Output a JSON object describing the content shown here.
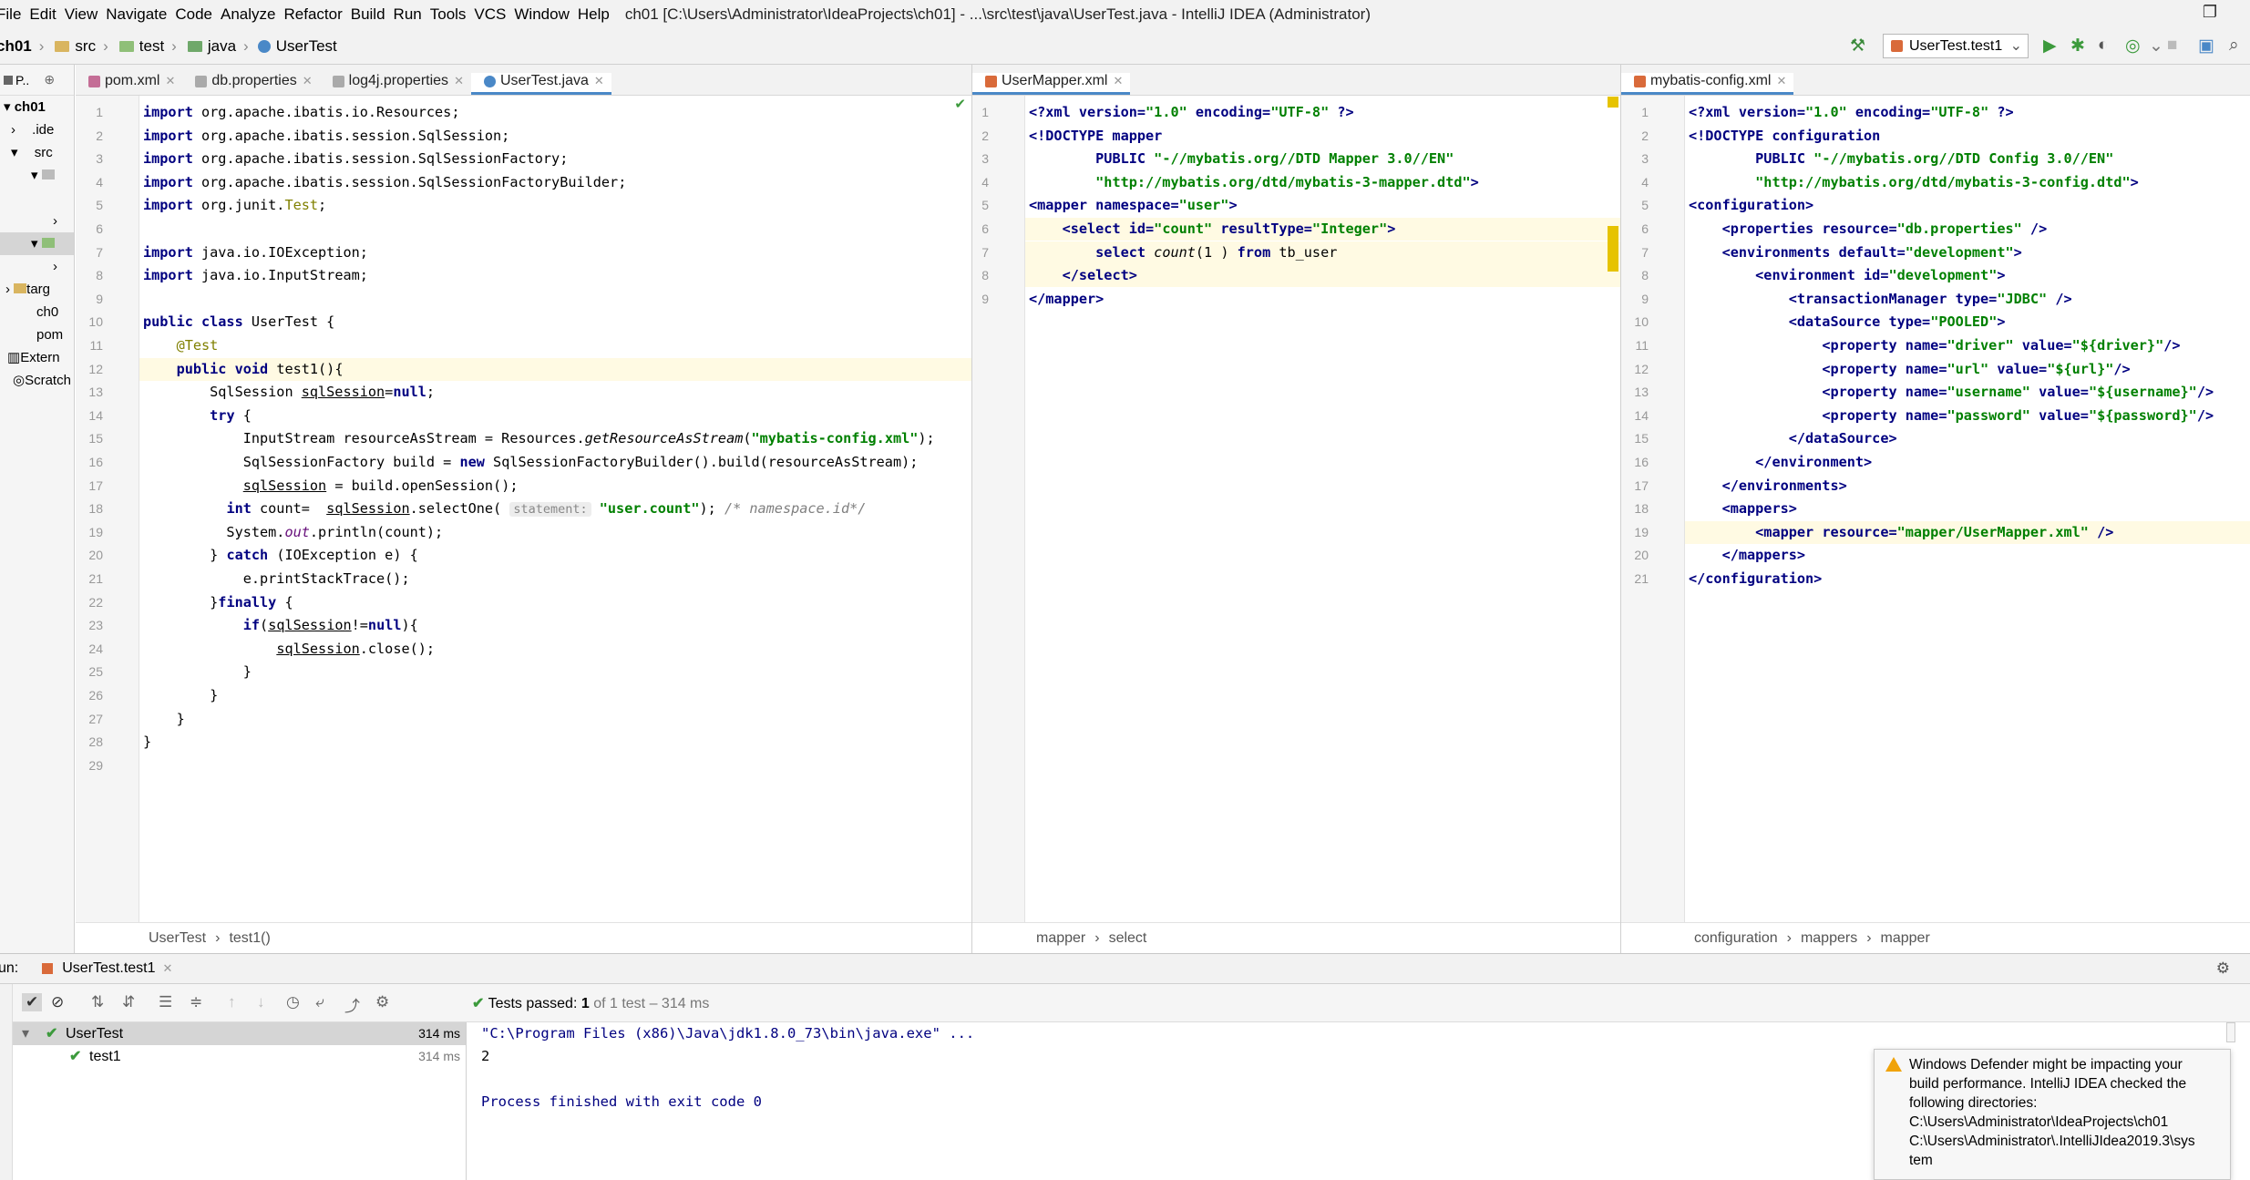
{
  "menubar": {
    "items": [
      "File",
      "Edit",
      "View",
      "Navigate",
      "Code",
      "Analyze",
      "Refactor",
      "Build",
      "Run",
      "Tools",
      "VCS",
      "Window",
      "Help"
    ],
    "title": "ch01 [C:\\Users\\Administrator\\IdeaProjects\\ch01] - ...\\src\\test\\java\\UserTest.java - IntelliJ IDEA (Administrator)"
  },
  "navbar": {
    "crumbs": [
      "ch01",
      "src",
      "test",
      "java",
      "UserTest"
    ],
    "run_config": "UserTest.test1"
  },
  "project": {
    "header": "P..",
    "items": [
      "ch01",
      ".ide",
      "src",
      "",
      "",
      "",
      "",
      "targ",
      "ch0",
      "pom",
      "Extern",
      "Scratch"
    ]
  },
  "editor1": {
    "tabs": [
      "pom.xml",
      "db.properties",
      "log4j.properties",
      "UserTest.java"
    ],
    "active": 3,
    "breadcrumb": [
      "UserTest",
      "test1()"
    ],
    "lines": [
      [
        [
          "kw",
          "import "
        ],
        [
          "",
          "org.apache.ibatis.io.Resources;"
        ]
      ],
      [
        [
          "kw",
          "import "
        ],
        [
          "",
          "org.apache.ibatis.session.SqlSession;"
        ]
      ],
      [
        [
          "kw",
          "import "
        ],
        [
          "",
          "org.apache.ibatis.session.SqlSessionFactory;"
        ]
      ],
      [
        [
          "kw",
          "import "
        ],
        [
          "",
          "org.apache.ibatis.session.SqlSessionFactoryBuilder;"
        ]
      ],
      [
        [
          "kw",
          "import "
        ],
        [
          "",
          "org.junit."
        ],
        [
          "ann",
          "Test"
        ],
        [
          "",
          ";"
        ]
      ],
      [],
      [
        [
          "kw",
          "import "
        ],
        [
          "",
          "java.io.IOException;"
        ]
      ],
      [
        [
          "kw",
          "import "
        ],
        [
          "",
          "java.io.InputStream;"
        ]
      ],
      [],
      [
        [
          "kw",
          "public class "
        ],
        [
          "",
          "UserTest {"
        ]
      ],
      [
        [
          "",
          "    "
        ],
        [
          "ann",
          "@Test"
        ]
      ],
      [
        [
          "",
          "    "
        ],
        [
          "kw",
          "public void "
        ],
        [
          "",
          "test1(){"
        ]
      ],
      [
        [
          "",
          "        SqlSession "
        ],
        [
          "ul",
          "sqlSession"
        ],
        [
          "",
          "="
        ],
        [
          "kw",
          "null"
        ],
        [
          "",
          ";"
        ]
      ],
      [
        [
          "",
          "        "
        ],
        [
          "kw",
          "try "
        ],
        [
          "",
          "{"
        ]
      ],
      [
        [
          "",
          "            InputStream resourceAsStream = Resources."
        ],
        [
          "it",
          "getResourceAsStream"
        ],
        [
          "",
          "("
        ],
        [
          "str",
          "\"mybatis-config.xml\""
        ],
        [
          "",
          ");"
        ]
      ],
      [
        [
          "",
          "            SqlSessionFactory build = "
        ],
        [
          "kw",
          "new "
        ],
        [
          "",
          "SqlSessionFactoryBuilder().build(resourceAsStream);"
        ]
      ],
      [
        [
          "",
          "            "
        ],
        [
          "ul",
          "sqlSession"
        ],
        [
          "",
          " = build.openSession();"
        ]
      ],
      [
        [
          "",
          "          "
        ],
        [
          "kw",
          "int "
        ],
        [
          "",
          "count=  "
        ],
        [
          "ul",
          "sqlSession"
        ],
        [
          "",
          ".selectOne( "
        ],
        [
          "hint",
          "statement:"
        ],
        [
          "",
          ""
        ],
        [
          "str",
          " \"user.count\""
        ],
        [
          "",
          ");"
        ],
        [
          "cm",
          " /* namespace.id*/"
        ]
      ],
      [
        [
          "",
          "          System."
        ],
        [
          "fld",
          "out"
        ],
        [
          "",
          ".println(count);"
        ]
      ],
      [
        [
          "",
          "        } "
        ],
        [
          "kw",
          "catch "
        ],
        [
          "",
          "(IOException e) {"
        ]
      ],
      [
        [
          "",
          "            e.printStackTrace();"
        ]
      ],
      [
        [
          "",
          "        }"
        ],
        [
          "kw",
          "finally "
        ],
        [
          "",
          "{"
        ]
      ],
      [
        [
          "",
          "            "
        ],
        [
          "kw",
          "if"
        ],
        [
          "",
          "("
        ],
        [
          "ul",
          "sqlSession"
        ],
        [
          "",
          "!="
        ],
        [
          "kw",
          "null"
        ],
        [
          "",
          "){"
        ]
      ],
      [
        [
          "",
          "                "
        ],
        [
          "ul",
          "sqlSession"
        ],
        [
          "",
          ".close();"
        ]
      ],
      [
        [
          "",
          "            }"
        ]
      ],
      [
        [
          "",
          "        }"
        ]
      ],
      [
        [
          "",
          "    }"
        ]
      ],
      [
        [
          "",
          "}"
        ]
      ],
      []
    ]
  },
  "editor2": {
    "tabs": [
      "UserMapper.xml"
    ],
    "active": 0,
    "breadcrumb": [
      "mapper",
      "select"
    ],
    "lines": [
      [
        [
          "tag",
          "<?xml "
        ],
        [
          "tag",
          "version="
        ],
        [
          "xv",
          "\"1.0\" "
        ],
        [
          "tag",
          "encoding="
        ],
        [
          "xv",
          "\"UTF-8\" "
        ],
        [
          "tag",
          "?>"
        ]
      ],
      [
        [
          "tag",
          "<!DOCTYPE mapper"
        ]
      ],
      [
        [
          "",
          "        "
        ],
        [
          "tag",
          "PUBLIC "
        ],
        [
          "xv",
          "\"-//mybatis.org//DTD Mapper 3.0//EN\""
        ]
      ],
      [
        [
          "",
          "        "
        ],
        [
          "xv",
          "\"http://mybatis.org/dtd/mybatis-3-mapper.dtd\""
        ],
        [
          "tag",
          ">"
        ]
      ],
      [
        [
          "tag",
          "<mapper "
        ],
        [
          "tag",
          "namespace="
        ],
        [
          "xv",
          "\"user\""
        ],
        [
          "tag",
          ">"
        ]
      ],
      [
        [
          "",
          "    "
        ],
        [
          "tag",
          "<select "
        ],
        [
          "tag",
          "id="
        ],
        [
          "xv",
          "\"count\" "
        ],
        [
          "tag",
          "resultType="
        ],
        [
          "xv",
          "\"Integer\""
        ],
        [
          "tag",
          ">"
        ]
      ],
      [
        [
          "",
          "        "
        ],
        [
          "kw",
          "select "
        ],
        [
          "it",
          "count"
        ],
        [
          "",
          "("
        ],
        [
          "",
          "1"
        ],
        [
          "",
          " ) "
        ],
        [
          "kw",
          "from "
        ],
        [
          "",
          "tb_user"
        ]
      ],
      [
        [
          "",
          "    "
        ],
        [
          "tag",
          "</select>"
        ]
      ],
      [
        [
          "tag",
          "</mapper>"
        ]
      ]
    ]
  },
  "editor3": {
    "tabs": [
      "mybatis-config.xml"
    ],
    "active": 0,
    "breadcrumb": [
      "configuration",
      "mappers",
      "mapper"
    ],
    "lines": [
      [
        [
          "tag",
          "<?xml "
        ],
        [
          "tag",
          "version="
        ],
        [
          "xv",
          "\"1.0\" "
        ],
        [
          "tag",
          "encoding="
        ],
        [
          "xv",
          "\"UTF-8\" "
        ],
        [
          "tag",
          "?>"
        ]
      ],
      [
        [
          "tag",
          "<!DOCTYPE configuration"
        ]
      ],
      [
        [
          "",
          "        "
        ],
        [
          "tag",
          "PUBLIC "
        ],
        [
          "xv",
          "\"-//mybatis.org//DTD Config 3.0//EN\""
        ]
      ],
      [
        [
          "",
          "        "
        ],
        [
          "xv",
          "\"http://mybatis.org/dtd/mybatis-3-config.dtd\""
        ],
        [
          "tag",
          ">"
        ]
      ],
      [
        [
          "tag",
          "<configuration>"
        ]
      ],
      [
        [
          "",
          "    "
        ],
        [
          "tag",
          "<properties "
        ],
        [
          "tag",
          "resource="
        ],
        [
          "xv",
          "\"db.properties\" "
        ],
        [
          "tag",
          "/>"
        ]
      ],
      [
        [
          "",
          "    "
        ],
        [
          "tag",
          "<environments "
        ],
        [
          "tag",
          "default="
        ],
        [
          "xv",
          "\"development\""
        ],
        [
          "tag",
          ">"
        ]
      ],
      [
        [
          "",
          "        "
        ],
        [
          "tag",
          "<environment "
        ],
        [
          "tag",
          "id="
        ],
        [
          "xv",
          "\"development\""
        ],
        [
          "tag",
          ">"
        ]
      ],
      [
        [
          "",
          "            "
        ],
        [
          "tag",
          "<transactionManager "
        ],
        [
          "tag",
          "type="
        ],
        [
          "xv",
          "\"JDBC\" "
        ],
        [
          "tag",
          "/>"
        ]
      ],
      [
        [
          "",
          "            "
        ],
        [
          "tag",
          "<dataSource "
        ],
        [
          "tag",
          "type="
        ],
        [
          "xv",
          "\"POOLED\""
        ],
        [
          "tag",
          ">"
        ]
      ],
      [
        [
          "",
          "                "
        ],
        [
          "tag",
          "<property "
        ],
        [
          "tag",
          "name="
        ],
        [
          "xv",
          "\"driver\" "
        ],
        [
          "tag",
          "value="
        ],
        [
          "xv",
          "\"${driver}\""
        ],
        [
          "tag",
          "/>"
        ]
      ],
      [
        [
          "",
          "                "
        ],
        [
          "tag",
          "<property "
        ],
        [
          "tag",
          "name="
        ],
        [
          "xv",
          "\"url\" "
        ],
        [
          "tag",
          "value="
        ],
        [
          "xv",
          "\"${url}\""
        ],
        [
          "tag",
          "/>"
        ]
      ],
      [
        [
          "",
          "                "
        ],
        [
          "tag",
          "<property "
        ],
        [
          "tag",
          "name="
        ],
        [
          "xv",
          "\"username\" "
        ],
        [
          "tag",
          "value="
        ],
        [
          "xv",
          "\"${username}\""
        ],
        [
          "tag",
          "/>"
        ]
      ],
      [
        [
          "",
          "                "
        ],
        [
          "tag",
          "<property "
        ],
        [
          "tag",
          "name="
        ],
        [
          "xv",
          "\"password\" "
        ],
        [
          "tag",
          "value="
        ],
        [
          "xv",
          "\"${password}\""
        ],
        [
          "tag",
          "/>"
        ]
      ],
      [
        [
          "",
          "            "
        ],
        [
          "tag",
          "</dataSource>"
        ]
      ],
      [
        [
          "",
          "        "
        ],
        [
          "tag",
          "</environment>"
        ]
      ],
      [
        [
          "",
          "    "
        ],
        [
          "tag",
          "</environments>"
        ]
      ],
      [
        [
          "",
          "    "
        ],
        [
          "tag",
          "<mappers>"
        ]
      ],
      [
        [
          "",
          "        "
        ],
        [
          "tag",
          "<mapper "
        ],
        [
          "tag",
          "resource="
        ],
        [
          "xv",
          "\"mapper/UserMapper.xml\" "
        ],
        [
          "tag",
          "/>"
        ]
      ],
      [
        [
          "",
          "    "
        ],
        [
          "tag",
          "</mappers>"
        ]
      ],
      [
        [
          "tag",
          "</configuration>"
        ]
      ]
    ]
  },
  "run": {
    "label": "un:",
    "tab": "UserTest.test1",
    "status_prefix": "Tests passed:",
    "status_count": "1",
    "status_suffix": "of 1 test – 314 ms",
    "tree": [
      {
        "name": "UserTest",
        "time": "314 ms"
      },
      {
        "name": "test1",
        "time": "314 ms"
      }
    ],
    "console": [
      "\"C:\\Program Files (x86)\\Java\\jdk1.8.0_73\\bin\\java.exe\" ...",
      "2",
      "",
      "Process finished with exit code 0"
    ]
  },
  "notification": {
    "lines": [
      "Windows Defender might be impacting your",
      "build performance. IntelliJ IDEA checked the",
      "following directories:",
      "C:\\Users\\Administrator\\IdeaProjects\\ch01",
      "C:\\Users\\Administrator\\.IntelliJIdea2019.3\\sys",
      "tem"
    ]
  }
}
